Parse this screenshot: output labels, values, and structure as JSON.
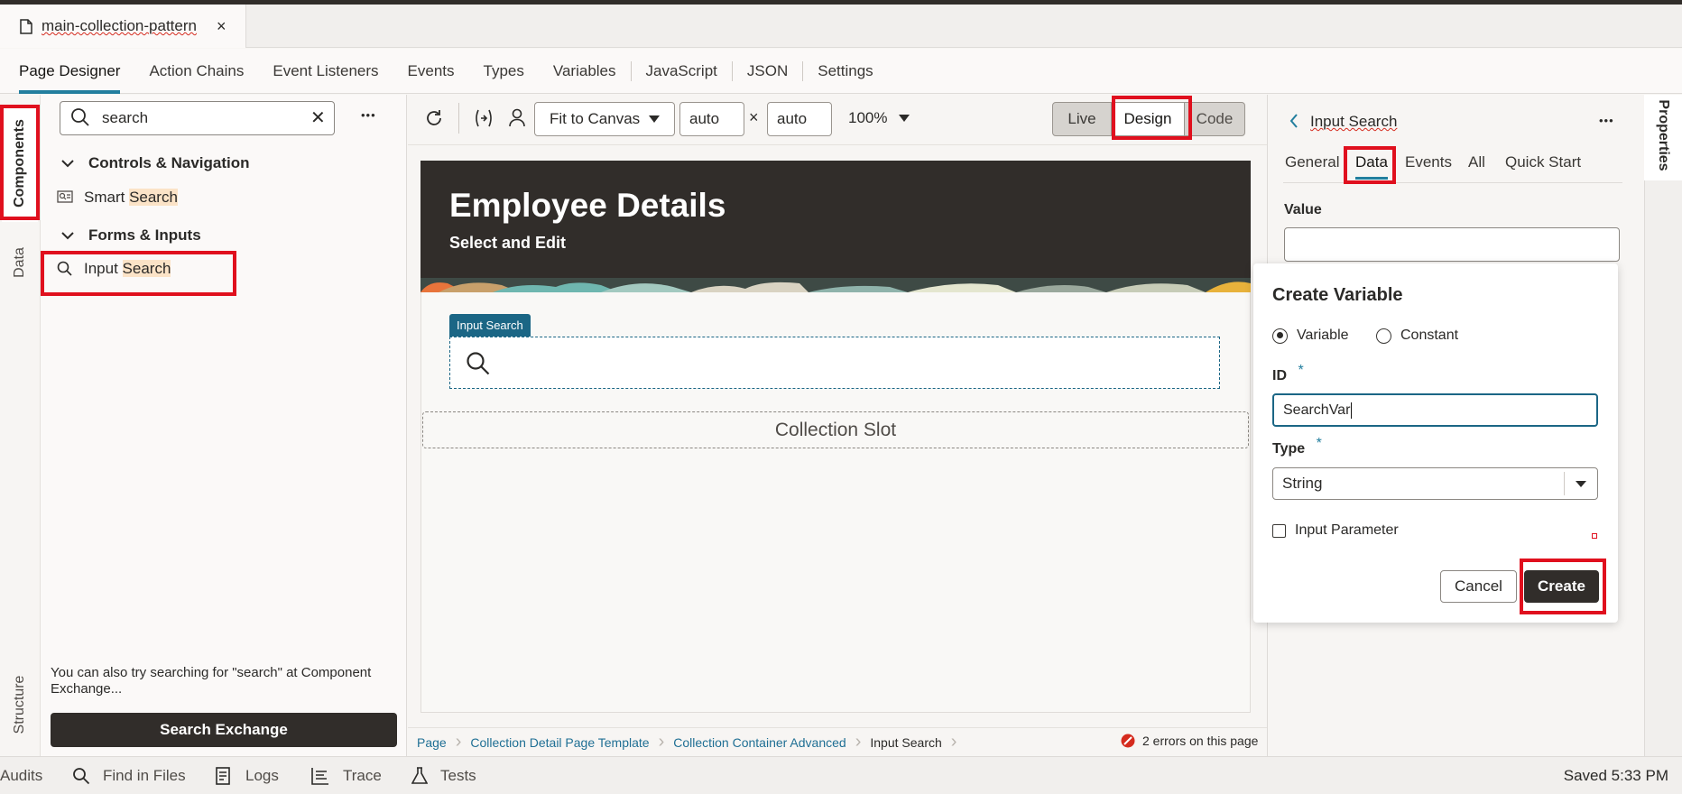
{
  "file_tab": {
    "name": "main-collection-pattern",
    "close": "×"
  },
  "nav_tabs": [
    "Page Designer",
    "Action Chains",
    "Event Listeners",
    "Events",
    "Types",
    "Variables",
    "JavaScript",
    "JSON",
    "Settings"
  ],
  "left_rail": {
    "components": "Components",
    "data": "Data",
    "structure": "Structure"
  },
  "components": {
    "search_value": "search",
    "clear": "✕",
    "more": "•••",
    "groups": [
      {
        "title": "Controls & Navigation",
        "item_prefix": "Smart ",
        "item_match": "Search"
      },
      {
        "title": "Forms & Inputs",
        "item_prefix": "Input ",
        "item_match": "Search"
      }
    ],
    "hint": "You can also try searching for \"search\" at Component Exchange...",
    "exchange_button": "Search Exchange"
  },
  "toolbar": {
    "fit": "Fit to Canvas",
    "width": "auto",
    "times": "×",
    "height": "auto",
    "zoom": "100%",
    "modes": [
      "Live",
      "Design",
      "Code"
    ],
    "active_mode": "Design"
  },
  "canvas": {
    "title": "Employee Details",
    "subtitle": "Select and Edit",
    "input_label": "Input Search",
    "slot": "Collection Slot"
  },
  "breadcrumbs": [
    "Page",
    "Collection Detail Page Template",
    "Collection Container Advanced",
    "Input Search"
  ],
  "errors": "2 errors on this page",
  "properties": {
    "rail_label": "Properties",
    "title": "Input Search",
    "more": "•••",
    "tabs": [
      "General",
      "Data",
      "Events",
      "All",
      "Quick Start"
    ],
    "active_tab": "Data",
    "value_label": "Value"
  },
  "create_variable": {
    "title": "Create Variable",
    "options": [
      "Variable",
      "Constant"
    ],
    "selected": "Variable",
    "id_label": "ID",
    "required": "*",
    "id_value": "SearchVar",
    "type_label": "Type",
    "type_value": "String",
    "input_parameter": "Input Parameter",
    "cancel": "Cancel",
    "create": "Create"
  },
  "status": {
    "items": [
      "Audits",
      "Find in Files",
      "Logs",
      "Trace",
      "Tests"
    ],
    "saved": "Saved 5:33 PM"
  },
  "colors": {
    "accent": "#227e9e",
    "highlight": "#e0101e",
    "dark": "#312d2a",
    "error": "#d52b1e"
  }
}
